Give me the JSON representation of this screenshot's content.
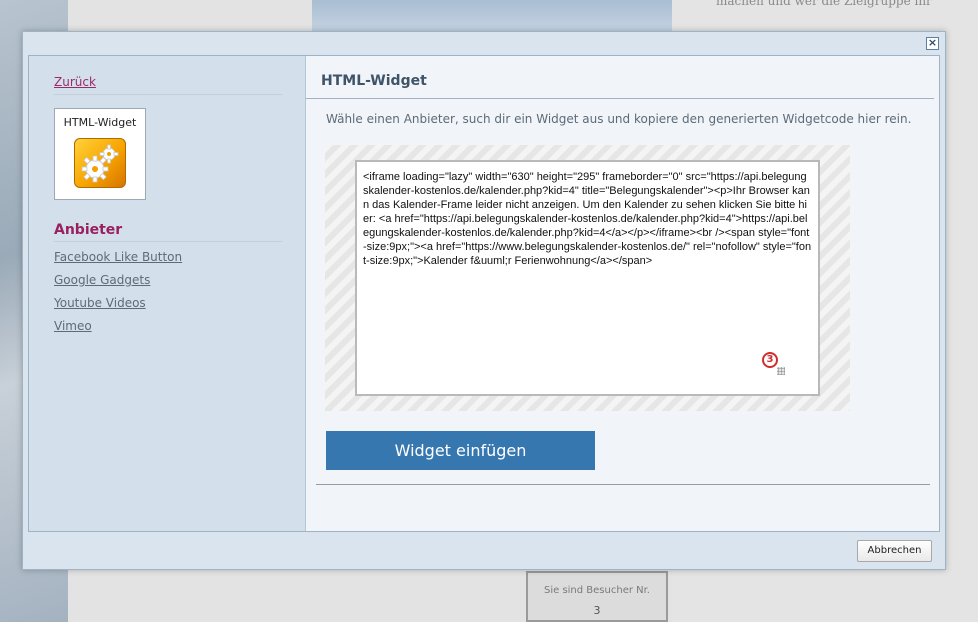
{
  "background": {
    "right_text": "machen und wer die Zielgruppe ihr",
    "counter": {
      "label": "Sie sind Besucher Nr.",
      "value": "3"
    }
  },
  "dialog": {
    "close_symbol": "×",
    "sidebar": {
      "back_label": "Zurück",
      "widget_card": {
        "label": "HTML-Widget",
        "icon": "gears-icon"
      },
      "providers_title": "Anbieter",
      "providers": [
        "Facebook Like Button",
        "Google Gadgets",
        "Youtube Videos",
        "Vimeo"
      ]
    },
    "main": {
      "title": "HTML-Widget",
      "instruction": "Wähle einen Anbieter, such dir ein Widget aus und kopiere den generierten Widgetcode hier rein.",
      "code": "<iframe loading=\"lazy\" width=\"630\" height=\"295\" frameborder=\"0\" src=\"https://api.belegungskalender-kostenlos.de/kalender.php?kid=4\" title=\"Belegungskalender\"><p>Ihr Browser kann das Kalender-Frame leider nicht anzeigen. Um den Kalender zu sehen klicken Sie bitte hier: <a href=\"https://api.belegungskalender-kostenlos.de/kalender.php?kid=4\">https://api.belegungskalender-kostenlos.de/kalender.php?kid=4</a></p></iframe><br /><span style=\"font-size:9px;\"><a href=\"https://www.belegungskalender-kostenlos.de/\" rel=\"nofollow\" style=\"font-size:9px;\">Kalender f&uuml;r Ferienwohnung</a></span>",
      "spellcheck_count": "3",
      "insert_button": "Widget einfügen"
    },
    "cancel_button": "Abbrechen"
  }
}
